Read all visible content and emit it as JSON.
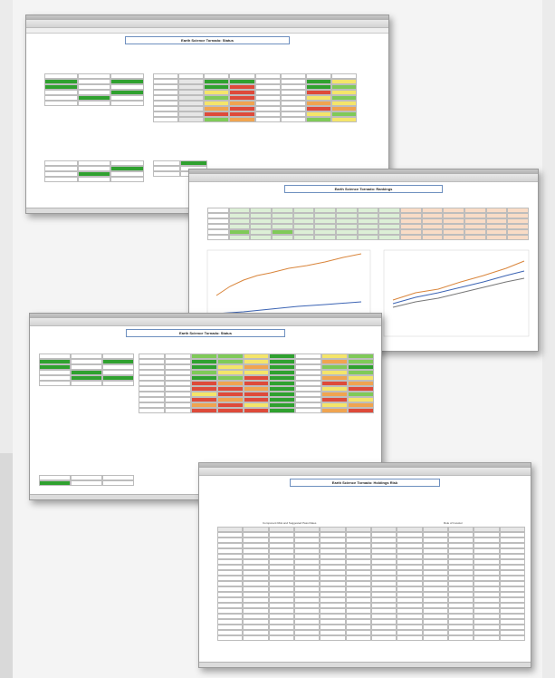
{
  "window1": {
    "title": "Earth Science Tornado: Status"
  },
  "window2": {
    "title": "Earth Science Tornado: Rankings"
  },
  "window3": {
    "title": "Earth Science Tornado: Status"
  },
  "window4": {
    "title": "Earth Science Tornado: Holdings Risk",
    "section_left": "Component Risk and Suggested Pass Rates",
    "section_right": "Role of Investor"
  },
  "colors": {
    "dark_green": "#2fa12f",
    "light_green": "#7fca58",
    "yellow": "#f4e56a",
    "orange": "#f0a450",
    "red": "#de4a3a",
    "line_orange": "#d9853b",
    "line_blue": "#3c64b4",
    "line_red": "#d03030"
  }
}
